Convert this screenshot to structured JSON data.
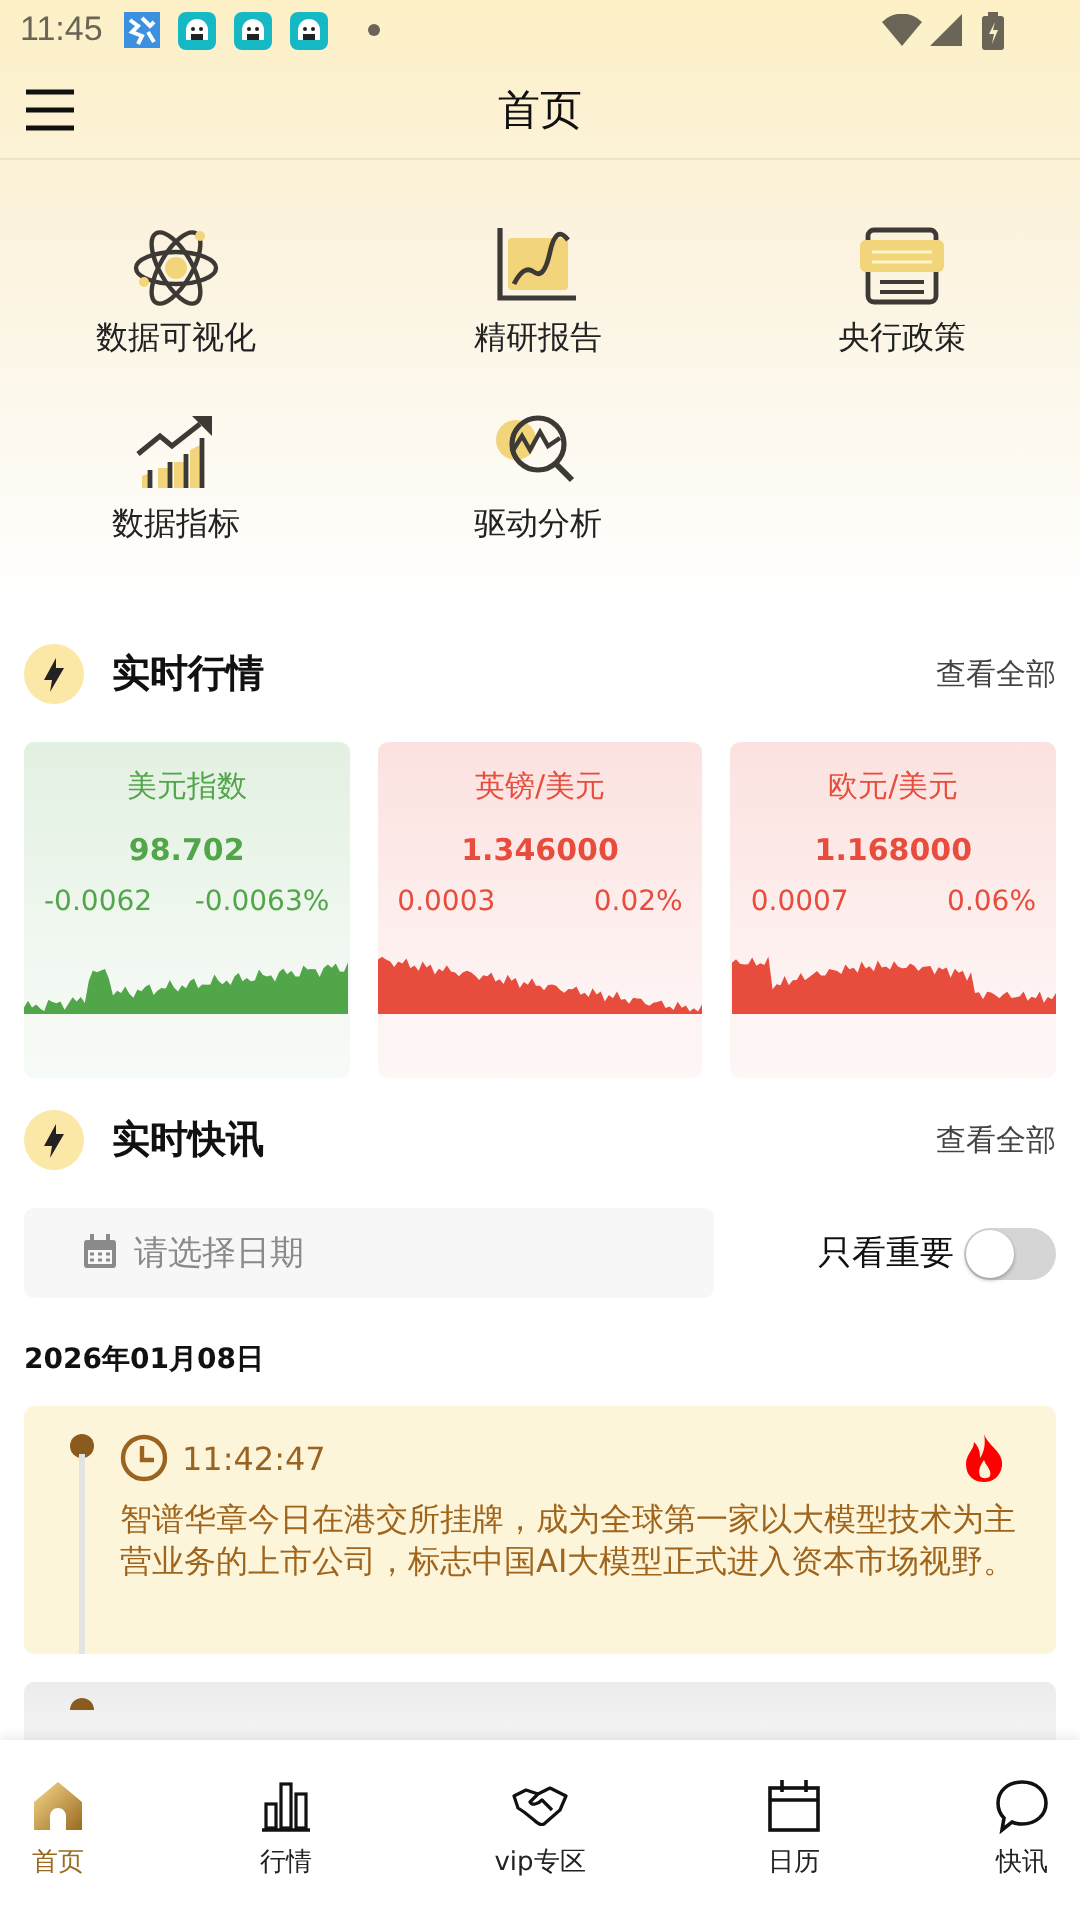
{
  "status_bar": {
    "time": "11:45"
  },
  "header": {
    "title": "首页"
  },
  "shortcuts": [
    {
      "label": "数据可视化",
      "kind": "atom"
    },
    {
      "label": "精研报告",
      "kind": "chart"
    },
    {
      "label": "央行政策",
      "kind": "document"
    },
    {
      "label": "数据指标",
      "kind": "trend"
    },
    {
      "label": "驱动分析",
      "kind": "analysis"
    }
  ],
  "market": {
    "title": "实时行情",
    "more": "查看全部",
    "cards": [
      {
        "name": "美元指数",
        "price": "98.702",
        "change": "-0.0062",
        "percent": "-0.0063%",
        "color": "#52a64a"
      },
      {
        "name": "英镑/美元",
        "price": "1.346000",
        "change": "0.0003",
        "percent": "0.02%",
        "color": "#e84c3d"
      },
      {
        "name": "欧元/美元",
        "price": "1.168000",
        "change": "0.0007",
        "percent": "0.06%",
        "color": "#e84c3d"
      }
    ]
  },
  "news": {
    "title": "实时快讯",
    "more": "查看全部",
    "date_field": {
      "placeholder": "请选择日期"
    },
    "filter": {
      "label": "只看重要",
      "on": false
    },
    "date": "2026年01月08日",
    "items": [
      {
        "kind": "full",
        "time": "11:42:47",
        "text": "智谱华章今日在港交所挂牌，成为全球第一家以大模型技术为主营业务的上市公司，标志中国AI大模型正式进入资本市场视野。",
        "hot": true
      },
      {
        "kind": "cut"
      }
    ]
  },
  "tab_bar": [
    {
      "label": "首页",
      "kind": "home",
      "selected": true
    },
    {
      "label": "行情",
      "kind": "bars",
      "selected": false
    },
    {
      "label": "vip专区",
      "kind": "handshake",
      "selected": false
    },
    {
      "label": "日历",
      "kind": "calendar",
      "selected": false
    },
    {
      "label": "快讯",
      "kind": "chat",
      "selected": false
    }
  ]
}
